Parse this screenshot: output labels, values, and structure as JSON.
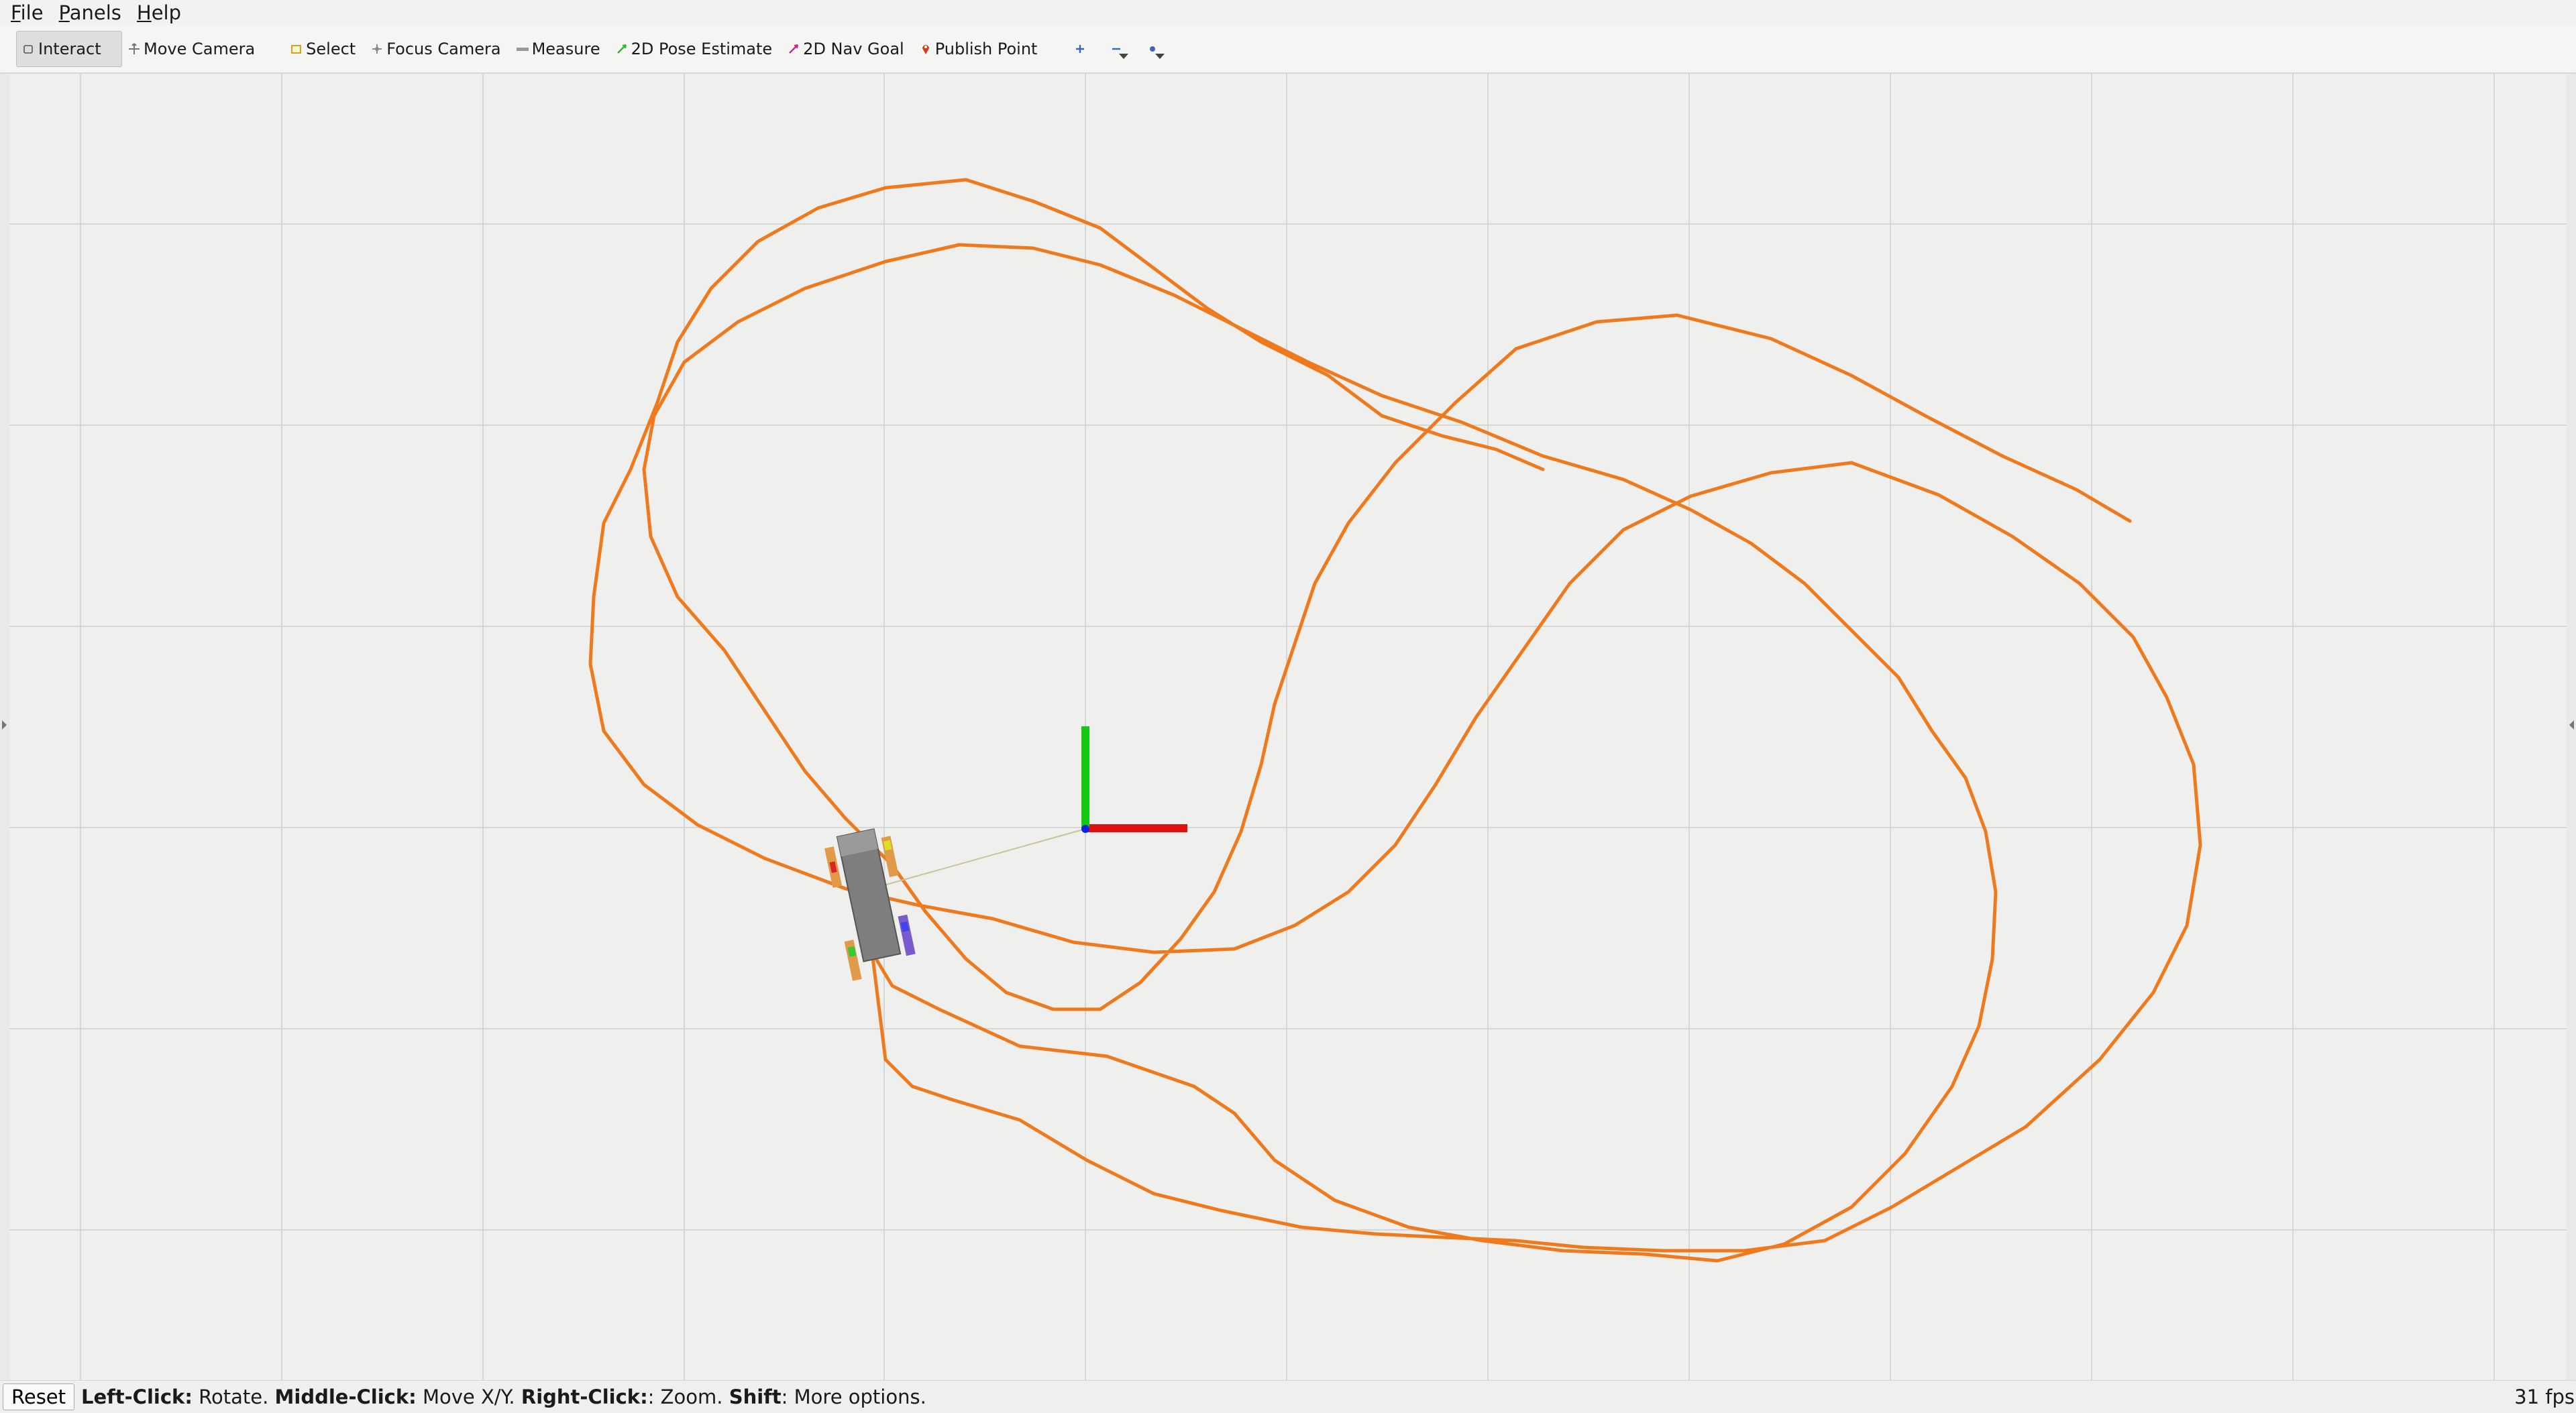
{
  "menu": [
    {
      "label": "File",
      "underline": "F",
      "rest": "ile"
    },
    {
      "label": "Panels",
      "underline": "P",
      "rest": "anels"
    },
    {
      "label": "Help",
      "underline": "H",
      "rest": "elp"
    }
  ],
  "toolbar": {
    "interact": "Interact",
    "move_camera": "Move Camera",
    "select": "Select",
    "focus_camera": "Focus Camera",
    "measure": "Measure",
    "pose_estimate": "2D Pose Estimate",
    "nav_goal": "2D Nav Goal",
    "publish_point": "Publish Point"
  },
  "status": {
    "reset": "Reset",
    "hint_left_key": "Left-Click:",
    "hint_left_val": " Rotate. ",
    "hint_middle_key": "Middle-Click:",
    "hint_middle_val": " Move X/Y. ",
    "hint_right_key": "Right-Click:",
    "hint_right_val": ": Zoom. ",
    "hint_shift_key": "Shift",
    "hint_shift_val": ": More options.",
    "fps": "31 fps"
  },
  "scene": {
    "path_color": "#ef7a1e",
    "x_axis_color": "#e01010",
    "y_axis_color": "#14c814",
    "z_axis_color": "#1020e0",
    "grid_color": "#d6d6d4"
  }
}
